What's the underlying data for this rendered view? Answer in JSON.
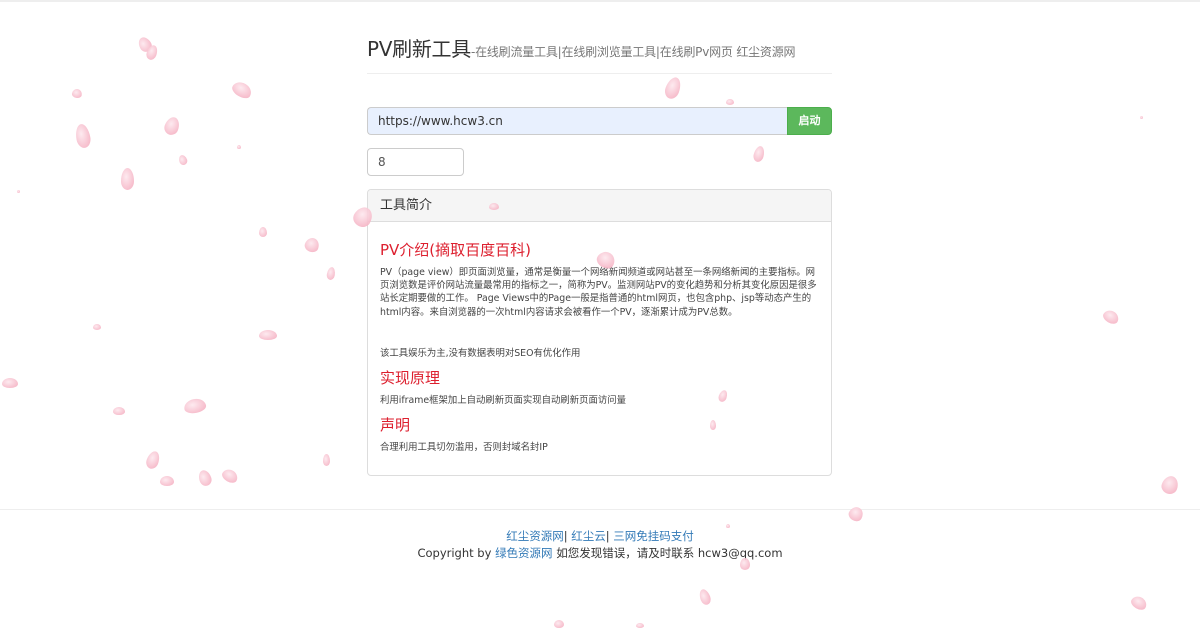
{
  "header": {
    "title": "PV刷新工具",
    "subtitle": "-在线刷流量工具|在线刷浏览量工具|在线刷Pv网页 红尘资源网"
  },
  "form": {
    "url_value": "https://www.hcw3.cn",
    "start_label": "启动",
    "count_value": "8"
  },
  "panel": {
    "heading": "工具简介",
    "sections": [
      {
        "title": "PV介绍(摘取百度百科)",
        "paragraphs": [
          "PV（page view）即页面浏览量，通常是衡量一个网络新闻频道或网站甚至一条网络新闻的主要指标。网页浏览数是评价网站流量最常用的指标之一，简称为PV。监测网站PV的变化趋势和分析其变化原因是很多站长定期要做的工作。 Page Views中的Page一般是指普通的html网页，也包含php、jsp等动态产生的html内容。来自浏览器的一次html内容请求会被看作一个PV，逐渐累计成为PV总数。",
          "该工具娱乐为主,没有数据表明对SEO有优化作用"
        ]
      },
      {
        "title": "实现原理",
        "paragraphs": [
          "利用iframe框架加上自动刷新页面实现自动刷新页面访问量"
        ]
      },
      {
        "title": "声明",
        "paragraphs": [
          "合理利用工具切勿滥用，否则封域名封IP"
        ]
      }
    ]
  },
  "footer": {
    "link1": "红尘资源网",
    "sep1": "|",
    "link2": "红尘云",
    "sep2": "|",
    "link3": "三网免挂码支付",
    "copy_prefix": "Copyright by",
    "copy_link": "绿色资源网",
    "copy_suffix": "如您发现错误，请及时联系 hcw3@qq.com"
  }
}
